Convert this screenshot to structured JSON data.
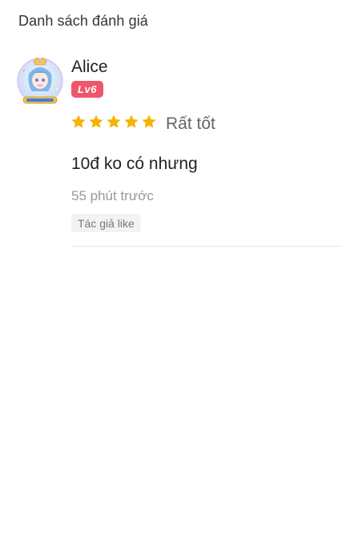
{
  "page": {
    "title": "Danh sách đánh giá"
  },
  "review": {
    "username": "Alice",
    "level": "Lv6",
    "rating": 5,
    "rating_max": 5,
    "rating_label": "Rất tốt",
    "comment": "10đ ko có nhưng",
    "time": "55 phút trước",
    "tag": "Tác giả like"
  },
  "colors": {
    "star": "#f5b400",
    "level_badge": "#f0566a",
    "divider": "#e8e8e8"
  }
}
